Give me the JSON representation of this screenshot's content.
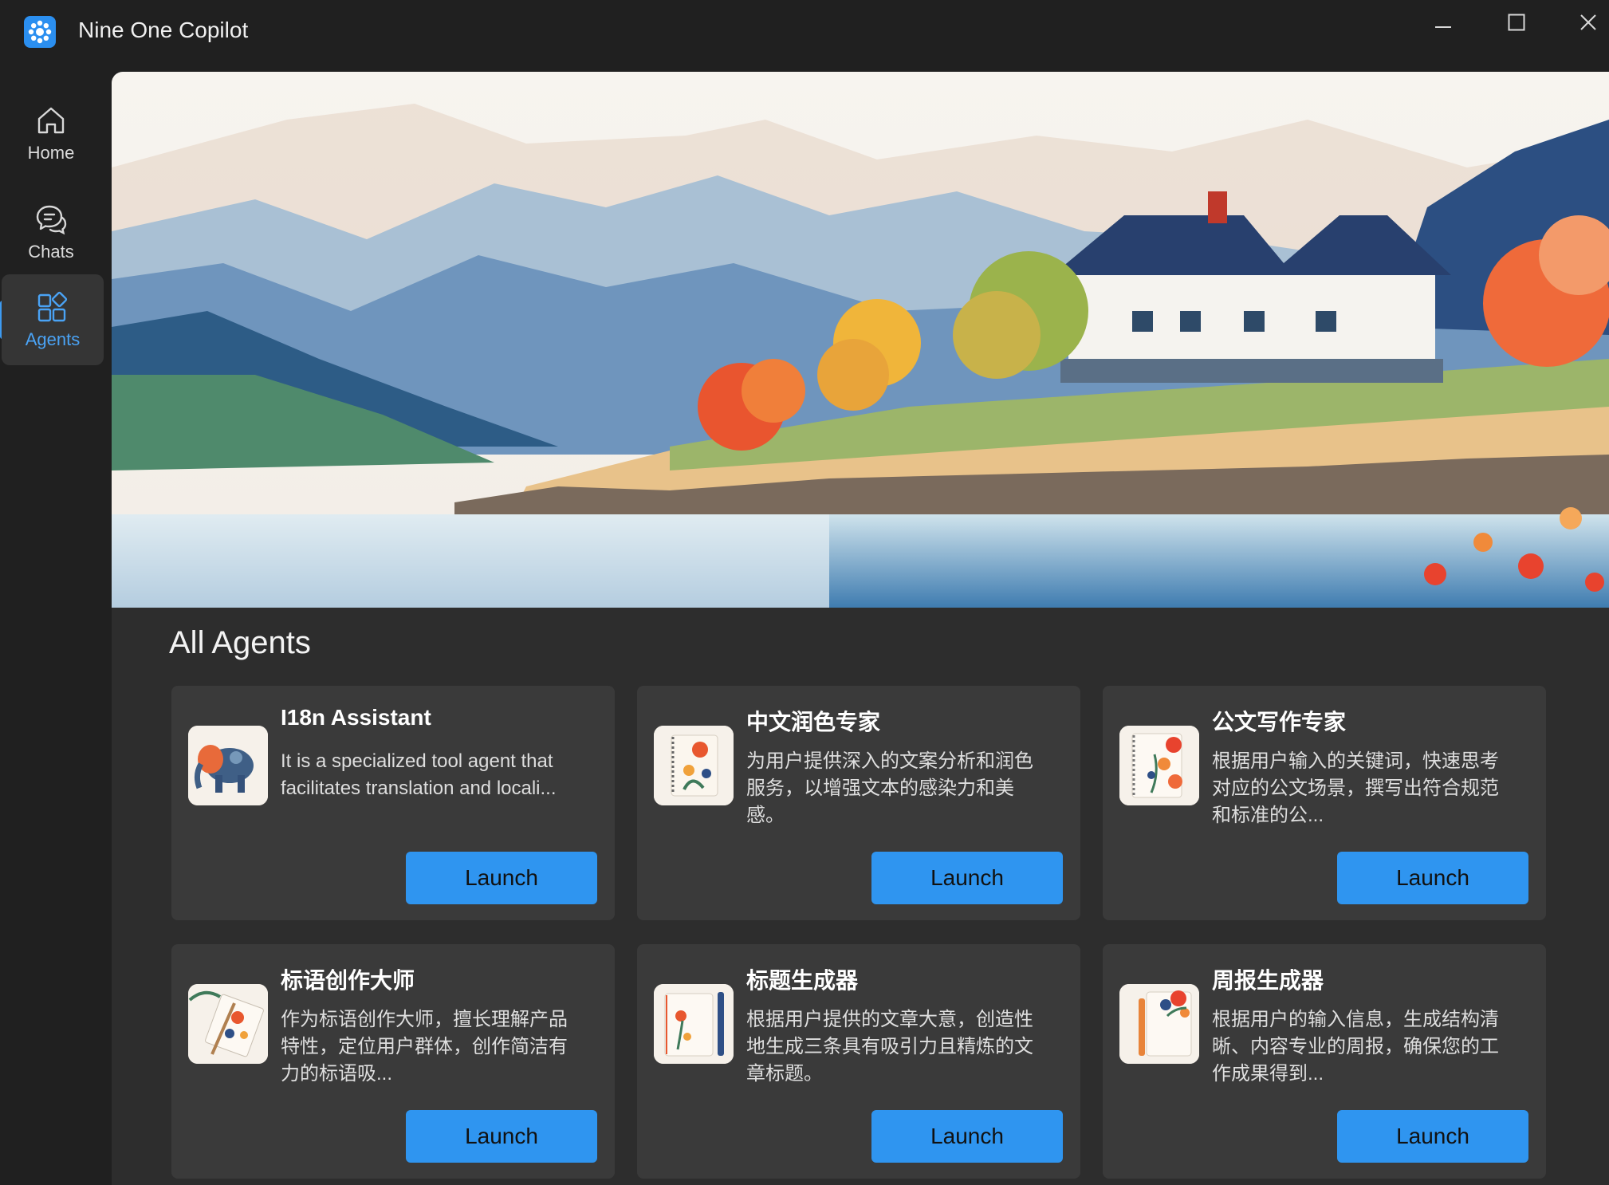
{
  "app": {
    "title": "Nine One Copilot",
    "logo_icon": "flower-logo-icon"
  },
  "window_controls": [
    "minimize-icon",
    "maximize-icon",
    "close-icon"
  ],
  "sidebar": {
    "items": [
      {
        "label": "Home",
        "icon": "home-icon",
        "active": false
      },
      {
        "label": "Chats",
        "icon": "chat-bubbles-icon",
        "active": false
      },
      {
        "label": "Agents",
        "icon": "agents-grid-icon",
        "active": true
      }
    ]
  },
  "main": {
    "section_title": "All Agents",
    "agents": [
      {
        "title": "I18n Assistant",
        "description": "It is a specialized tool agent that facilitates translation and locali...",
        "button": "Launch",
        "icon": "elephant-watercolor-icon"
      },
      {
        "title": "中文润色专家",
        "description": "为用户提供深入的文案分析和润色服务，以增强文本的感染力和美感。",
        "button": "Launch",
        "icon": "notebook-floral-icon"
      },
      {
        "title": "公文写作专家",
        "description": "根据用户输入的关键词，快速思考对应的公文场景，撰写出符合规范和标准的公...",
        "button": "Launch",
        "icon": "notebook-floral-icon"
      },
      {
        "title": "标语创作大师",
        "description": "作为标语创作大师，擅长理解产品特性，定位用户群体，创作简洁有力的标语吸...",
        "button": "Launch",
        "icon": "notebook-pen-icon"
      },
      {
        "title": "标题生成器",
        "description": "根据用户提供的文章大意，创造性地生成三条具有吸引力且精炼的文章标题。",
        "button": "Launch",
        "icon": "notebook-pen-icon"
      },
      {
        "title": "周报生成器",
        "description": "根据用户的输入信息，生成结构清晰、内容专业的周报，确保您的工作成果得到...",
        "button": "Launch",
        "icon": "notebook-pen-icon"
      }
    ]
  },
  "colors": {
    "accent": "#2f95f0",
    "sidebar_bg": "#202020",
    "card_bg": "#3a3a3a",
    "main_bg": "#2d2d2d"
  }
}
